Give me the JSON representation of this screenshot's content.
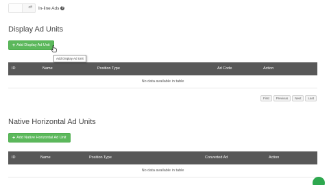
{
  "toggle": {
    "state": "off",
    "label": "In-line Ads"
  },
  "display_section": {
    "title": "Display Ad Units",
    "add_button": "Add Display Ad Unit",
    "tooltip": "Add Display Ad Unit",
    "columns": [
      "ID",
      "Name",
      "Position Type",
      "Ad Code",
      "Action"
    ],
    "empty": "No data available in table",
    "pagination": [
      "First",
      "Previous",
      "Next",
      "Last"
    ]
  },
  "native_section": {
    "title": "Native Horizontal Ad Units",
    "add_button": "Add Native Horizontal Ad Unit",
    "columns": [
      "ID",
      "Name",
      "Position Type",
      "Converted Ad",
      "Action"
    ],
    "empty": "No data available in table"
  },
  "icons": {
    "help": "question-circle-icon",
    "plus": "plus-icon",
    "cursor": "hand-pointer-icon"
  },
  "colors": {
    "green": "#5cb85c",
    "header": "#585858"
  }
}
